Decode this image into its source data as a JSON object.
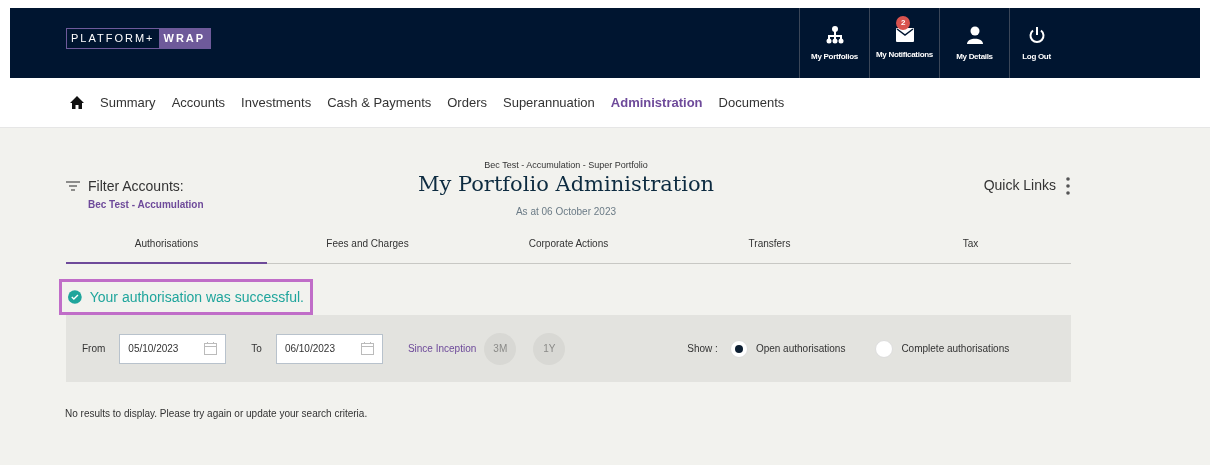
{
  "header": {
    "logo": {
      "left": "PLATFORM+",
      "right": "WRAP"
    },
    "actions": [
      {
        "kind": "portfolios",
        "label": "My Portfolios"
      },
      {
        "kind": "notifications",
        "label": "My Notifications",
        "badge": "2"
      },
      {
        "kind": "details",
        "label": "My Details"
      },
      {
        "kind": "logout",
        "label": "Log Out"
      }
    ]
  },
  "nav": [
    {
      "label": "Summary",
      "selected": false
    },
    {
      "label": "Accounts",
      "selected": false
    },
    {
      "label": "Investments",
      "selected": false
    },
    {
      "label": "Cash & Payments",
      "selected": false
    },
    {
      "label": "Orders",
      "selected": false
    },
    {
      "label": "Superannuation",
      "selected": false
    },
    {
      "label": "Administration",
      "selected": true
    },
    {
      "label": "Documents",
      "selected": false
    }
  ],
  "filter": {
    "label": "Filter Accounts:",
    "value": "Bec Test - Accumulation"
  },
  "title": {
    "account": "Bec Test - Accumulation - Super Portfolio",
    "heading": "My Portfolio Administration",
    "as_at": "As at  06 October 2023"
  },
  "quick_links": "Quick Links",
  "tabs": [
    {
      "label": "Authorisations",
      "selected": true
    },
    {
      "label": "Fees and Charges",
      "selected": false
    },
    {
      "label": "Corporate Actions",
      "selected": false
    },
    {
      "label": "Transfers",
      "selected": false
    },
    {
      "label": "Tax",
      "selected": false
    }
  ],
  "message": "Your authorisation was successful.",
  "filters": {
    "from_label": "From",
    "from": "05/10/2023",
    "to_label": "To",
    "to": "06/10/2023",
    "since_inception": "Since Inception",
    "periods": [
      {
        "label": "3M",
        "disabled": true
      },
      {
        "label": "1Y",
        "disabled": true
      }
    ],
    "show_label": "Show :",
    "options": [
      {
        "label": "Open authorisations",
        "selected": true
      },
      {
        "label": "Complete authorisations",
        "selected": false
      }
    ]
  },
  "empty_message": "No results to display. Please try again or update your search criteria."
}
